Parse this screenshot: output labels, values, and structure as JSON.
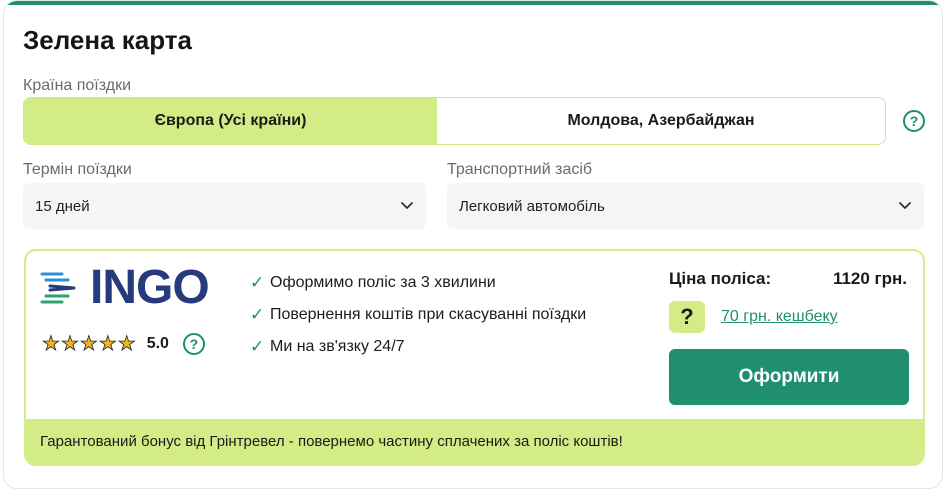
{
  "form": {
    "title": "Зелена карта",
    "country_label": "Країна поїздки",
    "country_options": [
      "Європа (Усі країни)",
      "Молдова, Азербайджан"
    ],
    "country_help_icon": "question-circle-icon",
    "term_label": "Термін поїздки",
    "term_value": "15 дней",
    "vehicle_label": "Транспортний засіб",
    "vehicle_value": "Легковий автомобіль"
  },
  "offer": {
    "brand": "INGO",
    "rating_stars": 5,
    "rating_value": "5.0",
    "features": [
      "Оформимо поліс за 3 хвилини",
      "Повернення коштів при скасуванні поїздки",
      "Ми на зв'язку 24/7"
    ],
    "price_label": "Ціна поліса:",
    "price_value": "1120 грн.",
    "cashback_text": "70 грн. кешбеку",
    "buy_label": "Оформити",
    "bonus_text": "Гарантований бонус від Грінтревел - повернемо частину сплачених за поліс коштів!"
  },
  "colors": {
    "accent": "#1f8f6f",
    "highlight": "#d4ec86",
    "brand_navy": "#263a7c",
    "star": "#f3b51e"
  }
}
